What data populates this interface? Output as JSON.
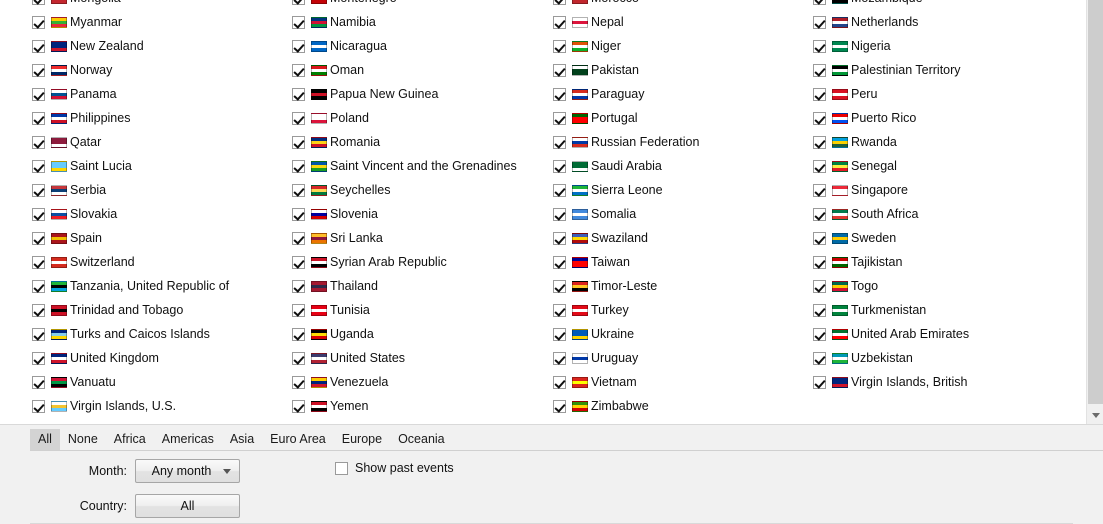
{
  "list": {
    "columns": [
      {
        "items": [
          {
            "name": "Mongolia",
            "checked": true,
            "clipped": true,
            "flag": [
              "#c4272f",
              "#015197",
              "#c4272f"
            ]
          },
          {
            "name": "Myanmar",
            "checked": true,
            "flag": [
              "#fecb00",
              "#34b233",
              "#ea2839"
            ]
          },
          {
            "name": "New Zealand",
            "checked": true,
            "flag": [
              "#00247d",
              "#00247d",
              "#cc142b"
            ]
          },
          {
            "name": "Norway",
            "checked": true,
            "flag": [
              "#ef2b2d",
              "#ffffff",
              "#002868"
            ]
          },
          {
            "name": "Panama",
            "checked": true,
            "flag": [
              "#ffffff",
              "#005293",
              "#d21034"
            ]
          },
          {
            "name": "Philippines",
            "checked": true,
            "flag": [
              "#0038a8",
              "#ffffff",
              "#ce1126"
            ]
          },
          {
            "name": "Qatar",
            "checked": true,
            "flag": [
              "#8d1b3d",
              "#8d1b3d",
              "#ffffff"
            ]
          },
          {
            "name": "Saint Lucia",
            "checked": true,
            "flag": [
              "#6cf",
              "#6cf",
              "#ffd700"
            ]
          },
          {
            "name": "Serbia",
            "checked": true,
            "flag": [
              "#c6363c",
              "#0c4076",
              "#ffffff"
            ]
          },
          {
            "name": "Slovakia",
            "checked": true,
            "flag": [
              "#ffffff",
              "#0b4ea2",
              "#ee1c25"
            ]
          },
          {
            "name": "Spain",
            "checked": true,
            "flag": [
              "#aa151b",
              "#f1bf00",
              "#aa151b"
            ]
          },
          {
            "name": "Switzerland",
            "checked": true,
            "flag": [
              "#d52b1e",
              "#ffffff",
              "#d52b1e"
            ]
          },
          {
            "name": "Tanzania, United Republic of",
            "checked": true,
            "flag": [
              "#1eb53a",
              "#000000",
              "#00a3dd"
            ]
          },
          {
            "name": "Trinidad and Tobago",
            "checked": true,
            "flag": [
              "#ce1126",
              "#000000",
              "#ce1126"
            ]
          },
          {
            "name": "Turks and Caicos Islands",
            "checked": true,
            "flag": [
              "#00247d",
              "#87ceeb",
              "#ffd700"
            ]
          },
          {
            "name": "United Kingdom",
            "checked": true,
            "flag": [
              "#00247d",
              "#ffffff",
              "#cf142b"
            ]
          },
          {
            "name": "Vanuatu",
            "checked": true,
            "flag": [
              "#d21034",
              "#009543",
              "#000000"
            ]
          },
          {
            "name": "Virgin Islands, U.S.",
            "checked": true,
            "flag": [
              "#ffffff",
              "#f4c430",
              "#6cf"
            ]
          }
        ]
      },
      {
        "items": [
          {
            "name": "Montenegro",
            "checked": true,
            "clipped": true,
            "flag": [
              "#c40308",
              "#d4af3a",
              "#c40308"
            ]
          },
          {
            "name": "Namibia",
            "checked": true,
            "flag": [
              "#003580",
              "#d21034",
              "#009543"
            ]
          },
          {
            "name": "Nicaragua",
            "checked": true,
            "flag": [
              "#0067c6",
              "#ffffff",
              "#0067c6"
            ]
          },
          {
            "name": "Oman",
            "checked": true,
            "flag": [
              "#db161b",
              "#ffffff",
              "#008000"
            ]
          },
          {
            "name": "Papua New Guinea",
            "checked": true,
            "flag": [
              "#000000",
              "#ce1126",
              "#000000"
            ]
          },
          {
            "name": "Poland",
            "checked": true,
            "flag": [
              "#ffffff",
              "#ffffff",
              "#dc143c"
            ]
          },
          {
            "name": "Romania",
            "checked": true,
            "flag": [
              "#002b7f",
              "#fcd116",
              "#ce1126"
            ]
          },
          {
            "name": "Saint Vincent and the Grenadines",
            "checked": true,
            "flag": [
              "#0058aa",
              "#f8d80e",
              "#199c22"
            ]
          },
          {
            "name": "Seychelles",
            "checked": true,
            "flag": [
              "#d62828",
              "#fcd856",
              "#007a3d"
            ]
          },
          {
            "name": "Slovenia",
            "checked": true,
            "flag": [
              "#ffffff",
              "#0000a0",
              "#d50000"
            ]
          },
          {
            "name": "Sri Lanka",
            "checked": true,
            "flag": [
              "#ffbe29",
              "#8d153a",
              "#eb7400"
            ]
          },
          {
            "name": "Syrian Arab Republic",
            "checked": true,
            "flag": [
              "#ce1126",
              "#ffffff",
              "#000000"
            ]
          },
          {
            "name": "Thailand",
            "checked": true,
            "flag": [
              "#a51931",
              "#2d2a4a",
              "#a51931"
            ]
          },
          {
            "name": "Tunisia",
            "checked": true,
            "flag": [
              "#e70013",
              "#ffffff",
              "#e70013"
            ]
          },
          {
            "name": "Uganda",
            "checked": true,
            "flag": [
              "#000000",
              "#fcdc04",
              "#d90000"
            ]
          },
          {
            "name": "United States",
            "checked": true,
            "flag": [
              "#3c3b6e",
              "#ffffff",
              "#b22234"
            ]
          },
          {
            "name": "Venezuela",
            "checked": true,
            "flag": [
              "#ffcc00",
              "#00247d",
              "#cf142b"
            ]
          },
          {
            "name": "Yemen",
            "checked": true,
            "flag": [
              "#ce1126",
              "#ffffff",
              "#000000"
            ]
          }
        ]
      },
      {
        "items": [
          {
            "name": "Morocco",
            "checked": true,
            "clipped": true,
            "flag": [
              "#c1272d",
              "#006233",
              "#c1272d"
            ]
          },
          {
            "name": "Nepal",
            "checked": true,
            "flag": [
              "#ffffff",
              "#dc143c",
              "#ffffff"
            ]
          },
          {
            "name": "Niger",
            "checked": true,
            "flag": [
              "#e05206",
              "#ffffff",
              "#0db02b"
            ]
          },
          {
            "name": "Pakistan",
            "checked": true,
            "flag": [
              "#ffffff",
              "#01411c",
              "#01411c"
            ]
          },
          {
            "name": "Paraguay",
            "checked": true,
            "flag": [
              "#d52b1e",
              "#ffffff",
              "#0038a8"
            ]
          },
          {
            "name": "Portugal",
            "checked": true,
            "flag": [
              "#006600",
              "#ff0000",
              "#ff0000"
            ]
          },
          {
            "name": "Russian Federation",
            "checked": true,
            "flag": [
              "#ffffff",
              "#0039a6",
              "#d52b1e"
            ]
          },
          {
            "name": "Saudi Arabia",
            "checked": true,
            "flag": [
              "#006c35",
              "#006c35",
              "#ffffff"
            ]
          },
          {
            "name": "Sierra Leone",
            "checked": true,
            "flag": [
              "#1eb53a",
              "#ffffff",
              "#0072c6"
            ]
          },
          {
            "name": "Somalia",
            "checked": true,
            "flag": [
              "#4189dd",
              "#ffffff",
              "#4189dd"
            ]
          },
          {
            "name": "Swaziland",
            "checked": true,
            "flag": [
              "#3e5eb9",
              "#ffd900",
              "#b10c0c"
            ]
          },
          {
            "name": "Taiwan",
            "checked": true,
            "flag": [
              "#000095",
              "#fe0000",
              "#fe0000"
            ]
          },
          {
            "name": "Timor-Leste",
            "checked": true,
            "flag": [
              "#dc241f",
              "#ffc726",
              "#000000"
            ]
          },
          {
            "name": "Turkey",
            "checked": true,
            "flag": [
              "#e30a17",
              "#ffffff",
              "#e30a17"
            ]
          },
          {
            "name": "Ukraine",
            "checked": true,
            "flag": [
              "#005bbb",
              "#005bbb",
              "#ffd500"
            ]
          },
          {
            "name": "Uruguay",
            "checked": true,
            "flag": [
              "#ffffff",
              "#0038a8",
              "#ffffff"
            ]
          },
          {
            "name": "Vietnam",
            "checked": true,
            "flag": [
              "#da251d",
              "#ffff00",
              "#da251d"
            ]
          },
          {
            "name": "Zimbabwe",
            "checked": true,
            "flag": [
              "#319208",
              "#ffd200",
              "#d40000"
            ]
          }
        ]
      },
      {
        "items": [
          {
            "name": "Mozambique",
            "checked": true,
            "clipped": true,
            "flag": [
              "#007168",
              "#fce100",
              "#000000"
            ]
          },
          {
            "name": "Netherlands",
            "checked": true,
            "flag": [
              "#ae1c28",
              "#ffffff",
              "#21468b"
            ]
          },
          {
            "name": "Nigeria",
            "checked": true,
            "flag": [
              "#008751",
              "#ffffff",
              "#008751"
            ]
          },
          {
            "name": "Palestinian Territory",
            "checked": true,
            "flag": [
              "#000000",
              "#ffffff",
              "#009736"
            ]
          },
          {
            "name": "Peru",
            "checked": true,
            "flag": [
              "#d91023",
              "#ffffff",
              "#d91023"
            ]
          },
          {
            "name": "Puerto Rico",
            "checked": true,
            "flag": [
              "#ed0000",
              "#ffffff",
              "#0050f0"
            ]
          },
          {
            "name": "Rwanda",
            "checked": true,
            "flag": [
              "#00a1de",
              "#fad201",
              "#20603d"
            ]
          },
          {
            "name": "Senegal",
            "checked": true,
            "flag": [
              "#00853f",
              "#fdef42",
              "#e31b23"
            ]
          },
          {
            "name": "Singapore",
            "checked": true,
            "flag": [
              "#ed2939",
              "#ffffff",
              "#ffffff"
            ]
          },
          {
            "name": "South Africa",
            "checked": true,
            "flag": [
              "#007a4d",
              "#ffffff",
              "#de3831"
            ]
          },
          {
            "name": "Sweden",
            "checked": true,
            "flag": [
              "#006aa7",
              "#fecc00",
              "#006aa7"
            ]
          },
          {
            "name": "Tajikistan",
            "checked": true,
            "flag": [
              "#cc0000",
              "#ffffff",
              "#006600"
            ]
          },
          {
            "name": "Togo",
            "checked": true,
            "flag": [
              "#006a4e",
              "#ffce00",
              "#d21034"
            ]
          },
          {
            "name": "Turkmenistan",
            "checked": true,
            "flag": [
              "#00843d",
              "#ffffff",
              "#00843d"
            ]
          },
          {
            "name": "United Arab Emirates",
            "checked": true,
            "flag": [
              "#00732f",
              "#ffffff",
              "#ff0000"
            ]
          },
          {
            "name": "Uzbekistan",
            "checked": true,
            "flag": [
              "#0099b5",
              "#ffffff",
              "#1eb53a"
            ]
          },
          {
            "name": "Virgin Islands, British",
            "checked": true,
            "flag": [
              "#00247d",
              "#00247d",
              "#cf142b"
            ]
          }
        ]
      }
    ]
  },
  "scrollbar": {
    "down_arrow": "scroll-down-arrow"
  },
  "region_tabs": {
    "selected": "All",
    "items": [
      {
        "label": "All"
      },
      {
        "label": "None"
      },
      {
        "label": "Africa"
      },
      {
        "label": "Americas"
      },
      {
        "label": "Asia"
      },
      {
        "label": "Euro Area"
      },
      {
        "label": "Europe"
      },
      {
        "label": "Oceania"
      }
    ]
  },
  "form": {
    "month_label": "Month:",
    "month_value": "Any month",
    "country_label": "Country:",
    "country_value": "All",
    "show_past_events_label": "Show past events",
    "show_past_events_checked": false
  }
}
